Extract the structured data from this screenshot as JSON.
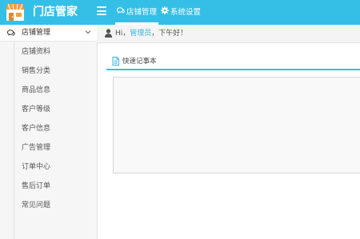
{
  "app": {
    "title": "门店管家"
  },
  "nav": {
    "store_management": "店铺管理",
    "system_settings": "系统设置"
  },
  "sidebar": {
    "header": "店铺管理",
    "items": [
      "店铺资料",
      "销售分类",
      "商品信息",
      "客户等级",
      "客户信息",
      "广告管理",
      "订单中心",
      "售后订单",
      "常见问题"
    ]
  },
  "greeting": {
    "prefix": "Hi，",
    "role": "管理员",
    "suffix": "，下午好！"
  },
  "panel": {
    "tab_label": "快速记事本",
    "notepad_value": ""
  },
  "colors": {
    "primary": "#35bfe6",
    "accent_text": "#35b4e0"
  },
  "icons": {
    "logo": "shop-logo-icon",
    "menu": "hamburger-icon",
    "store": "chat-bubbles-icon",
    "settings": "gear-icon",
    "sidebar_header": "chat-bubbles-icon",
    "chevron": "chevron-down-icon",
    "user": "user-icon",
    "doc": "document-icon"
  }
}
